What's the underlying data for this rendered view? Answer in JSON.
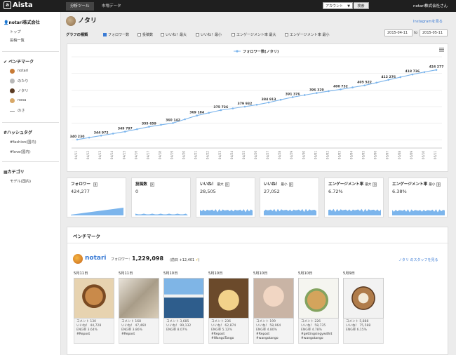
{
  "topbar": {
    "logo": "Aista",
    "logo_mark": "a",
    "tabs": [
      "分析ツール",
      "市場データ"
    ],
    "account_select": "アカウント",
    "search_button": "検索",
    "company": "notari株式会社さん"
  },
  "sidebar": {
    "org": "notari株式会社",
    "links": [
      "トップ",
      "投稿一覧"
    ],
    "benchmark_header": "ベンチマーク",
    "benchmark_items": [
      "notari",
      "のたり",
      "ノタリ",
      "nosa",
      "のさ"
    ],
    "hashtag_header": "ハッシュタグ",
    "hashtags": [
      "#fashion(国内)",
      "#love(国内)"
    ],
    "category_header": "カテゴリ",
    "categories": [
      "モデル(国内)"
    ]
  },
  "page": {
    "title": "ノタリ",
    "instagram_link": "Instagramを見る",
    "graph_type_label": "グラフの種類",
    "graph_options": [
      {
        "label": "フォロワー数",
        "checked": true
      },
      {
        "label": "投稿数",
        "checked": false
      },
      {
        "label": "いいね！最大",
        "checked": false
      },
      {
        "label": "いいね！最小",
        "checked": false
      },
      {
        "label": "エンゲージメント率 最大",
        "checked": false
      },
      {
        "label": "エンゲージメント率 最小",
        "checked": false
      }
    ],
    "date_from": "2015-04-11",
    "date_to_label": "to",
    "date_to": "2015-05-11"
  },
  "chart_data": {
    "type": "line",
    "legend": "フォロワー数(ノタリ)",
    "series": [
      {
        "name": "フォロワー数(ノタリ)",
        "values": [
          340230,
          342600,
          344972,
          347400,
          349787,
          352700,
          355659,
          358000,
          360142,
          364700,
          369184,
          372500,
          375726,
          377800,
          379932,
          382200,
          384913,
          388200,
          391376,
          393900,
          396329,
          398600,
          400732,
          403100,
          405522,
          408900,
          412276,
          415500,
          418736,
          421600,
          424277
        ]
      }
    ],
    "data_labels": [
      "340 230",
      "344 972",
      "349 787",
      "355 659",
      "360 142",
      "369 184",
      "375 726",
      "379 932",
      "384 913",
      "391 376",
      "396 329",
      "400 732",
      "405 522",
      "412 276",
      "418 736",
      "424 277"
    ],
    "x_labels": [
      "04/11",
      "04/12",
      "04/13",
      "04/14",
      "04/15",
      "04/16",
      "04/17",
      "04/18",
      "04/19",
      "04/20",
      "04/21",
      "04/22",
      "04/23",
      "04/24",
      "04/25",
      "04/26",
      "04/27",
      "04/28",
      "04/29",
      "04/30",
      "05/01",
      "05/02",
      "05/03",
      "05/04",
      "05/05",
      "05/06",
      "05/07",
      "05/08",
      "05/09",
      "05/10",
      "05/11"
    ],
    "ylim": [
      330000,
      440000
    ],
    "grid": true,
    "legend_position": "top-center",
    "color": "#7cb5ec"
  },
  "stats": [
    {
      "title": "フォロワー",
      "sub": "",
      "value": "424,277",
      "shape": "ramp"
    },
    {
      "title": "投稿数",
      "sub": "",
      "value": "0",
      "shape": "flat"
    },
    {
      "title": "いいね！",
      "sub": "最大",
      "value": "28,505",
      "shape": "wave"
    },
    {
      "title": "いいね！",
      "sub": "最小",
      "value": "27,052",
      "shape": "wave"
    },
    {
      "title": "エンゲージメント率",
      "sub": "最大",
      "value": "6.72%",
      "shape": "wave"
    },
    {
      "title": "エンゲージメント率",
      "sub": "最小",
      "value": "6.38%",
      "shape": "wave"
    }
  ],
  "benchmark": {
    "header": "ベンチマーク",
    "account": "notari",
    "followers_label": "フォロワー：",
    "followers": "1,229,098",
    "change": "(前日 +12,401",
    "change_icon": "⚡",
    "change_close": ")",
    "staff_link": "ノタリ のスタッフを見る",
    "posts": [
      {
        "date": "5月11日",
        "comments": "コメント 130",
        "likes": "いいね！ 44,728",
        "eng": "ENG率 3.64%",
        "tags": "#Repost"
      },
      {
        "date": "5月11日",
        "comments": "コメント 168",
        "likes": "いいね！ 47,460",
        "eng": "ENG率 3.86%",
        "tags": "#Repost"
      },
      {
        "date": "5月10日",
        "comments": "コメント 3,685",
        "likes": "いいね！ 99,132",
        "eng": "ENG率 8.07%",
        "tags": ""
      },
      {
        "date": "5月10日",
        "comments": "コメント 236",
        "likes": "いいね！ 62,874",
        "eng": "ENG率 5.12%",
        "tags": "#Repost\n#WangoTango"
      },
      {
        "date": "5月10日",
        "comments": "コメント 199",
        "likes": "いいね！ 58,964",
        "eng": "ENG率 4.80%",
        "tags": "#Repost\n#wangotango"
      },
      {
        "date": "5月10日",
        "comments": "コメント 226",
        "likes": "いいね！ 58,735",
        "eng": "ENG率 4.78%",
        "tags": "#gettingsingywithit\n#wangotango"
      },
      {
        "date": "5月9日",
        "comments": "コメント 5,888",
        "likes": "いいね！ 75,588",
        "eng": "ENG率 6.15%",
        "tags": ""
      }
    ]
  }
}
